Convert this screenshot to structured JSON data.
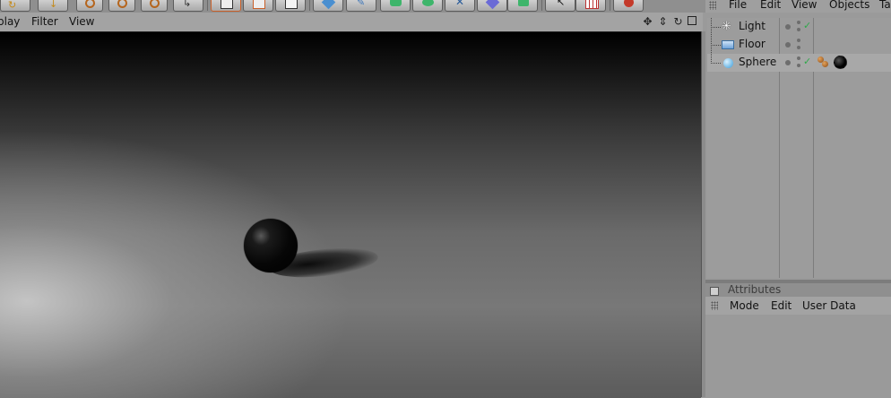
{
  "viewport_menu": [
    "play",
    "Filter",
    "View"
  ],
  "viewport_nav_icons": [
    "move-view-icon",
    "dolly-view-icon",
    "rotate-view-icon",
    "maximize-view-icon"
  ],
  "object_manager": {
    "menu": [
      "File",
      "Edit",
      "View",
      "Objects",
      "Ta"
    ],
    "objects": [
      {
        "name": "Light",
        "icon": "light-icon"
      },
      {
        "name": "Floor",
        "icon": "floor-icon"
      },
      {
        "name": "Sphere",
        "icon": "sphere-icon"
      }
    ]
  },
  "attributes": {
    "title": "Attributes",
    "menu": [
      "Mode",
      "Edit",
      "User Data"
    ]
  }
}
